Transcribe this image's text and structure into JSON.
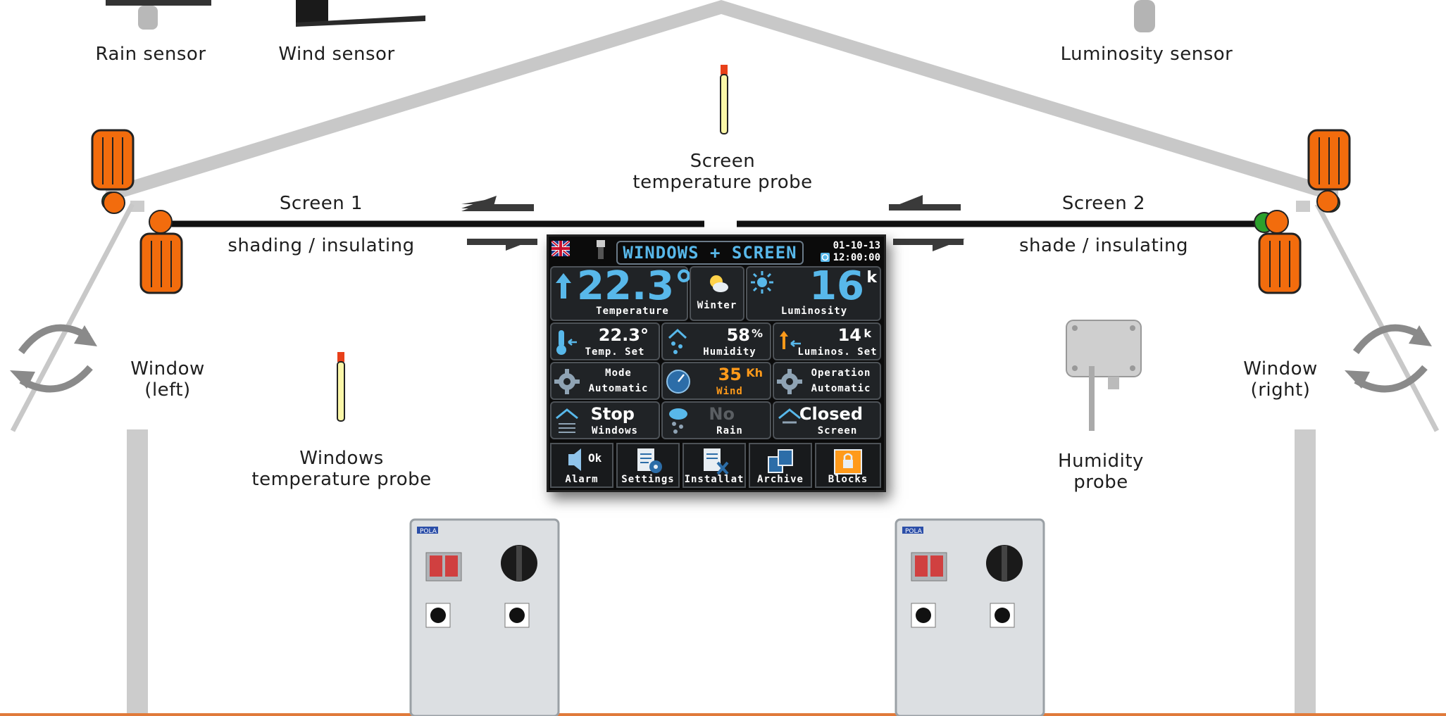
{
  "labels": {
    "rain_sensor": "Rain sensor",
    "wind_sensor": "Wind sensor",
    "luminosity_sensor": "Luminosity sensor",
    "screen_probe_line1": "Screen",
    "screen_probe_line2": "temperature probe",
    "screen1_title": "Screen 1",
    "screen1_sub": "shading / insulating",
    "screen2_title": "Screen 2",
    "screen2_sub": "shade / insulating",
    "window_left_line1": "Window",
    "window_left_line2": "(left)",
    "window_right_line1": "Window",
    "window_right_line2": "(right)",
    "windows_probe_line1": "Windows",
    "windows_probe_line2": "temperature probe",
    "humidity_probe_line1": "Humidity",
    "humidity_probe_line2": "probe"
  },
  "controller": {
    "title": "WINDOWS + SCREEN",
    "date": "01-10-13",
    "time": "12:00:00",
    "temperature": {
      "value": "22.3°",
      "label": "Temperature"
    },
    "season": {
      "label": "Winter"
    },
    "luminosity": {
      "value": "16",
      "unit": "k",
      "label": "Luminosity"
    },
    "temp_set": {
      "value": "22.3°",
      "label": "Temp. Set"
    },
    "humidity": {
      "value": "58",
      "unit": "%",
      "label": "Humidity"
    },
    "lumin_set": {
      "value": "14",
      "unit": "k",
      "label": "Luminos. Set"
    },
    "mode": {
      "line1": "Mode",
      "line2": "Automatic"
    },
    "wind": {
      "value": "35",
      "unit": "Kh",
      "label": "Wind"
    },
    "operation": {
      "line1": "Operation",
      "line2": "Automatic"
    },
    "windows_state": {
      "value": "Stop",
      "label": "Windows"
    },
    "rain_state": {
      "value": "No",
      "label": "Rain"
    },
    "screen_state": {
      "value": "Closed",
      "label": "Screen"
    },
    "alarm_status": "Ok",
    "buttons": [
      "Alarm",
      "Settings",
      "Installat",
      "Archive",
      "Blocks"
    ]
  },
  "control_boxes": {
    "brand": "POLA"
  },
  "colors": {
    "roof": "#c8c8c8",
    "motor": "#f26c0d",
    "screen_line": "#111111",
    "display_blue": "#58b8ea",
    "display_orange": "#ff9a1a",
    "accent_bottom": "#e07a3a"
  }
}
